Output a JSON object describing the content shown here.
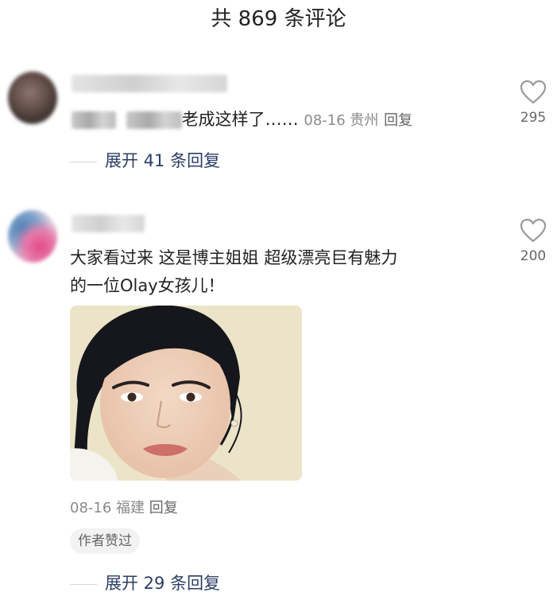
{
  "header": {
    "title": "共 869 条评论"
  },
  "comments": [
    {
      "text_visible": "老成这样了……",
      "meta": "08-16 贵州",
      "reply_label": "回复",
      "likes": "295",
      "expand_label": "展开 41 条回复"
    },
    {
      "text_line1": "大家看过来  这是博主姐姐  超级漂亮巨有魅力",
      "text_line2": "的一位Olay女孩儿！",
      "meta": "08-16 福建",
      "reply_label": "回复",
      "likes": "200",
      "author_badge": "作者赞过",
      "expand_label": "展开 29 条回复"
    }
  ],
  "icons": {
    "like": "heart-outline-icon"
  },
  "colors": {
    "expand_link": "#2c3e66",
    "meta_text": "#8a8a8a",
    "like_icon": "#9a9a9a"
  }
}
